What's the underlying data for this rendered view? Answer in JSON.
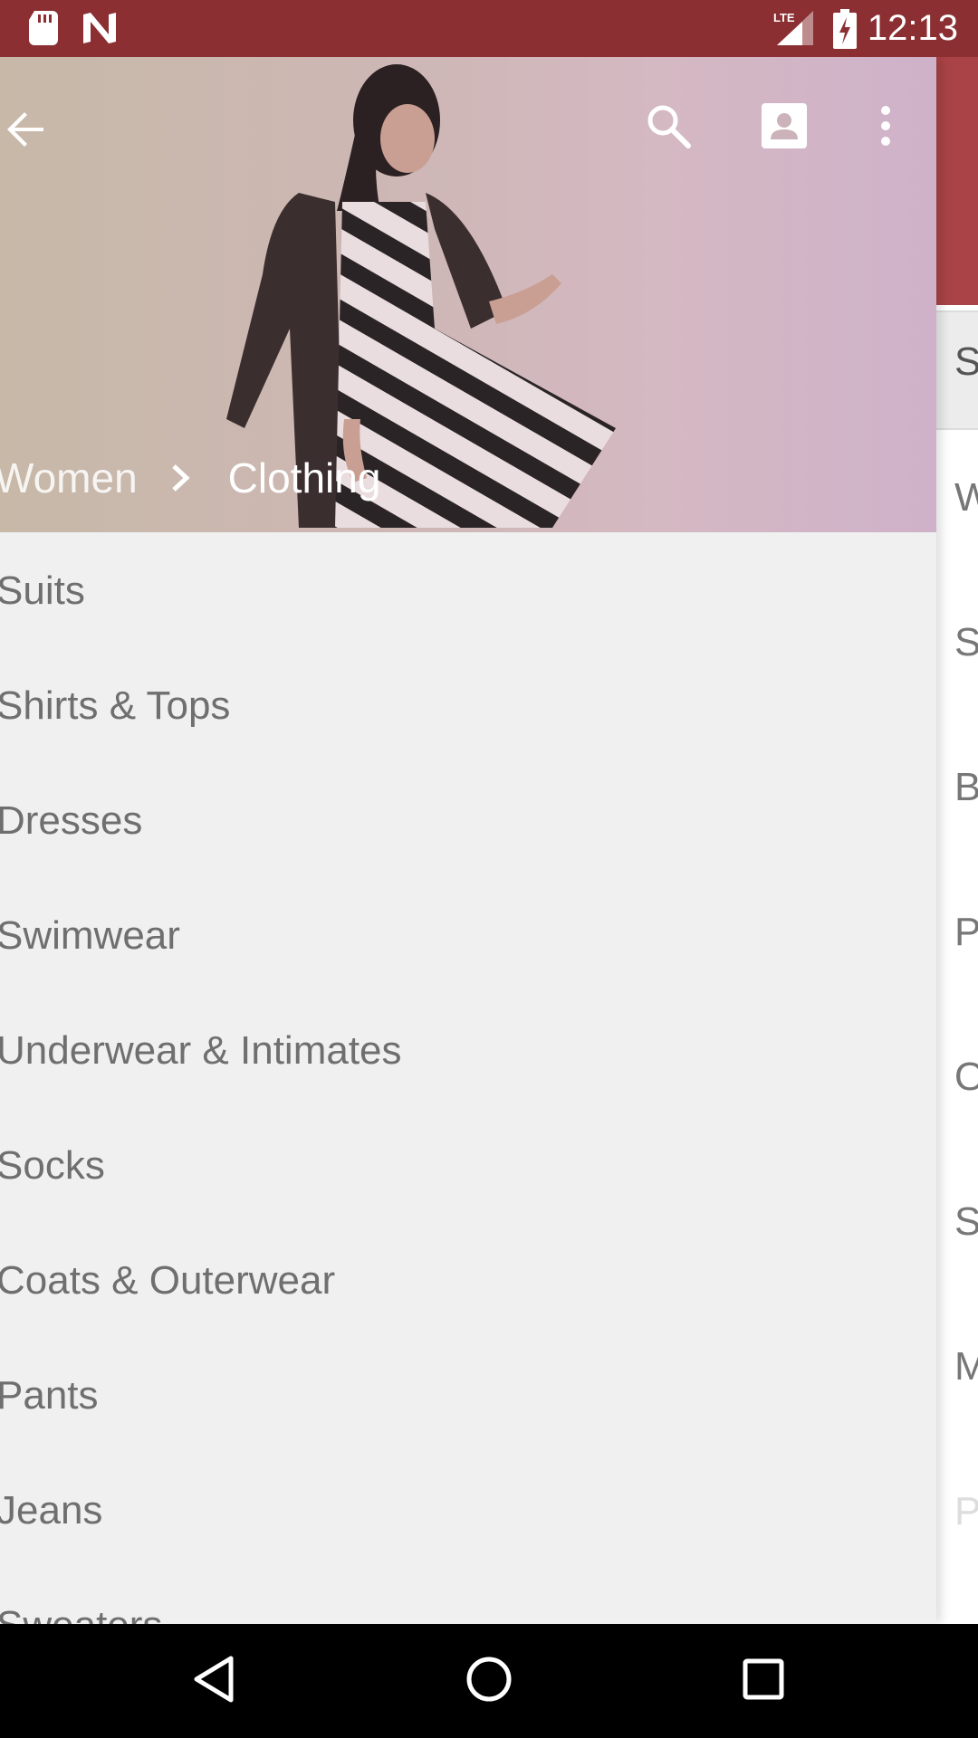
{
  "status_bar": {
    "time": "12:13",
    "network": "LTE",
    "icons": [
      "sd-card-icon",
      "notification-n-icon",
      "signal-icon",
      "battery-charging-icon"
    ]
  },
  "app_bar": {
    "icons": [
      "back-arrow-icon",
      "search-icon",
      "account-icon",
      "overflow-menu-icon"
    ]
  },
  "breadcrumb": {
    "parent": "Women",
    "current": "Clothing"
  },
  "categories": [
    "Suits",
    "Shirts & Tops",
    "Dresses",
    "Swimwear",
    "Underwear & Intimates",
    "Socks",
    "Coats & Outerwear",
    "Pants",
    "Jeans",
    "Sweaters"
  ],
  "background_panel": {
    "letters": [
      "S",
      "W",
      "S",
      "B",
      "P",
      "O",
      "S",
      "M",
      "P"
    ]
  },
  "colors": {
    "status_bar": "#8b2f32",
    "accent_red": "#a94347",
    "drawer_bg": "#f0f0f0",
    "item_text": "#6f6f6f"
  },
  "nav_bar": {
    "icons": [
      "back-triangle-icon",
      "home-circle-icon",
      "recents-square-icon"
    ]
  }
}
